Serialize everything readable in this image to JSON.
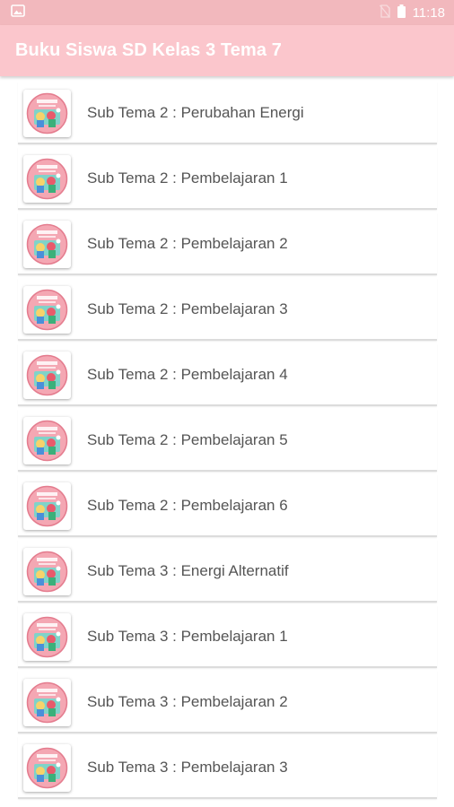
{
  "status_bar": {
    "time": "11:18",
    "icons": [
      "image-icon",
      "no-sim-icon",
      "battery-icon"
    ]
  },
  "app_bar": {
    "title": "Buku Siswa SD Kelas 3 Tema 7"
  },
  "colors": {
    "status_bar": "#f2b8bd",
    "app_bar": "#fbc6cc",
    "item_text": "#555555"
  },
  "items": [
    {
      "label": "Sub Tema 2 : Perubahan Energi"
    },
    {
      "label": "Sub Tema 2 : Pembelajaran 1"
    },
    {
      "label": "Sub Tema 2 : Pembelajaran 2"
    },
    {
      "label": "Sub Tema 2 : Pembelajaran 3"
    },
    {
      "label": "Sub Tema 2 : Pembelajaran 4"
    },
    {
      "label": "Sub Tema 2 : Pembelajaran 5"
    },
    {
      "label": "Sub Tema 2 : Pembelajaran 6"
    },
    {
      "label": "Sub Tema 3 : Energi Alternatif"
    },
    {
      "label": "Sub Tema 3 : Pembelajaran 1"
    },
    {
      "label": "Sub Tema 3 : Pembelajaran 2"
    },
    {
      "label": "Sub Tema 3 : Pembelajaran 3"
    }
  ]
}
